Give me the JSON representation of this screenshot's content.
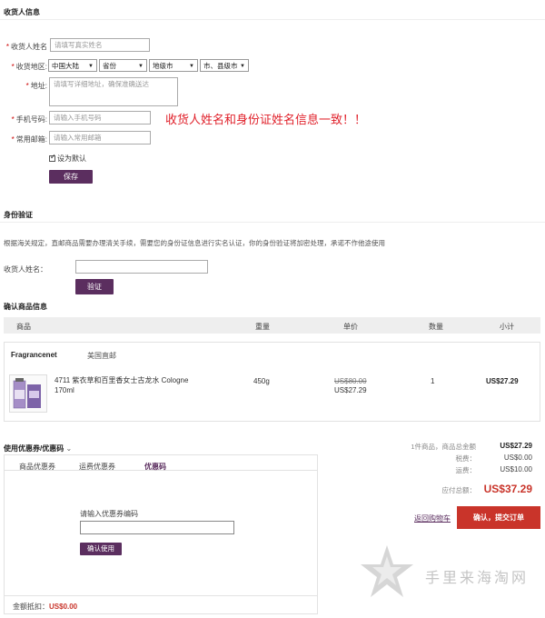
{
  "shipping": {
    "section_title": "收货人信息",
    "name_label": "收货人姓名",
    "name_placeholder": "请填写真实姓名",
    "region_label": "收货地区",
    "country": "中国大陆",
    "province": "省份",
    "city": "地级市",
    "district": "市、县级市",
    "address_label": "地址",
    "address_placeholder": "请填写详细地址，确保准确送达",
    "phone_label": "手机号码",
    "phone_placeholder": "请输入手机号码",
    "email_label": "常用邮箱",
    "email_placeholder": "请输入常用邮箱",
    "default_label": "设为默认",
    "save_label": "保存",
    "name_note": "收货人姓名和身份证姓名信息一致！！"
  },
  "identity": {
    "section_title": "身份验证",
    "description": "根据海关规定，直邮商品需要办理清关手续，需要您的身份证信息进行实名认证，你的身份验证将加密处理，承诺不作他途使用",
    "name_label": "收货人姓名：",
    "verify_label": "验证"
  },
  "order": {
    "section_title": "确认商品信息",
    "columns": [
      "商品",
      "重量",
      "单价",
      "数量",
      "小计"
    ],
    "store_name": "Fragrancenet",
    "shipping_type": "美国直邮",
    "item": {
      "name": "4711 紫衣草和百里香女士古龙水 Cologne 170ml",
      "weight": "450g",
      "original_price": "US$80.00",
      "price": "US$27.29",
      "quantity": "1",
      "subtotal": "US$27.29"
    }
  },
  "coupon": {
    "section_title": "使用优惠券/优惠码",
    "tabs": [
      "商品优惠券",
      "运费优惠券",
      "优惠码"
    ],
    "code_label": "请输入优惠券编码",
    "confirm_label": "确认使用",
    "discount_label": "金额抵扣：",
    "discount_value": "US$0.00"
  },
  "summary": {
    "goods_label": "1件商品，商品总金额",
    "goods_value": "US$27.29",
    "tax_label": "税费：",
    "tax_value": "US$0.00",
    "shipping_label": "运费：",
    "shipping_value": "US$10.00",
    "total_label": "应付总额：",
    "total_value": "US$37.29",
    "back_label": "返回购物车",
    "submit_label": "确认，提交订单"
  },
  "watermark": {
    "text": "手里来海淘网"
  },
  "colors": {
    "brand_purple": "#5b2e5f",
    "accent_red": "#c9342a",
    "note_red": "#e0202a"
  }
}
